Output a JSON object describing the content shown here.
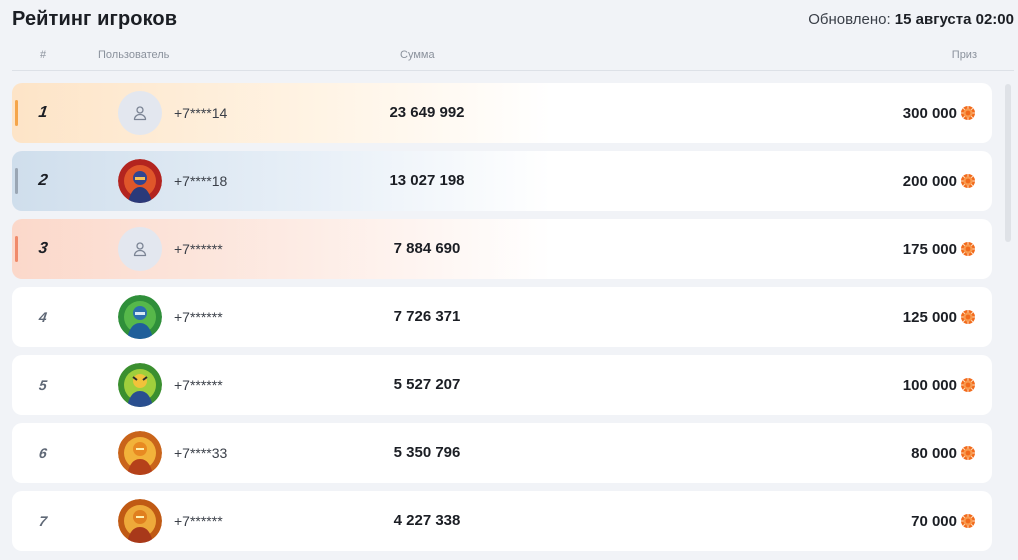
{
  "header": {
    "title": "Рейтинг игроков",
    "updated_label": "Обновлено:",
    "updated_value": "15 августа 02:00"
  },
  "columns": {
    "rank": "#",
    "user": "Пользователь",
    "sum": "Сумма",
    "prize": "Приз"
  },
  "colors": {
    "gold": "#f5a54a",
    "silver": "#9aa6b4",
    "bronze": "#f08a6a",
    "coin": "#f26a1b"
  },
  "rows": [
    {
      "rank": "1",
      "phone": "+7****14",
      "sum": "23 649 992",
      "prize": "300 000",
      "avatar": "default-user-icon"
    },
    {
      "rank": "2",
      "phone": "+7****18",
      "sum": "13 027 198",
      "prize": "200 000",
      "avatar": "hero-avatar"
    },
    {
      "rank": "3",
      "phone": "+7******",
      "sum": "7 884 690",
      "prize": "175 000",
      "avatar": "default-user-icon"
    },
    {
      "rank": "4",
      "phone": "+7******",
      "sum": "7 726 371",
      "prize": "125 000",
      "avatar": "hero-avatar"
    },
    {
      "rank": "5",
      "phone": "+7******",
      "sum": "5 527 207",
      "prize": "100 000",
      "avatar": "hero-avatar"
    },
    {
      "rank": "6",
      "phone": "+7****33",
      "sum": "5 350 796",
      "prize": "80 000",
      "avatar": "hero-avatar"
    },
    {
      "rank": "7",
      "phone": "+7******",
      "sum": "4 227 338",
      "prize": "70 000",
      "avatar": "hero-avatar"
    }
  ]
}
